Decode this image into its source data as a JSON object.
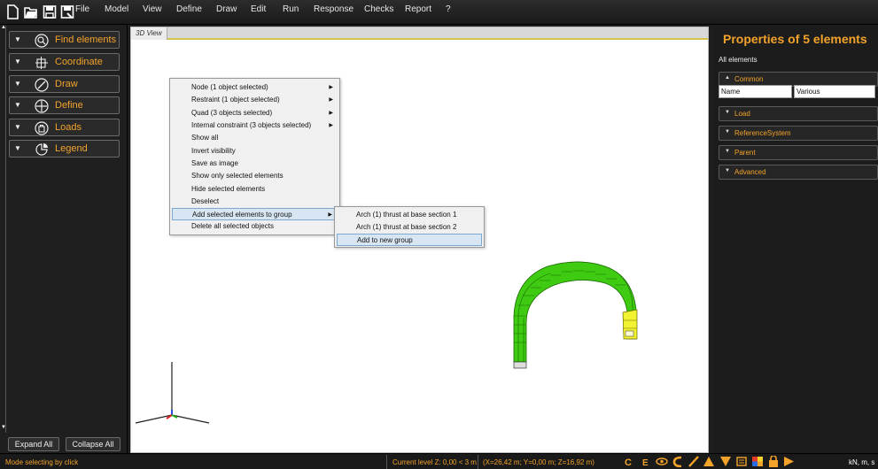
{
  "menubar": {
    "items": [
      "File",
      "Model",
      "View",
      "Define",
      "Draw",
      "Edit",
      "Run",
      "Response",
      "Checks",
      "Report",
      "?"
    ]
  },
  "left_panel": {
    "buttons": [
      {
        "label": "Find elements",
        "icon": "search-icon"
      },
      {
        "label": "Coordinate",
        "icon": "coordinate-icon"
      },
      {
        "label": "Draw",
        "icon": "draw-icon"
      },
      {
        "label": "Define",
        "icon": "define-icon"
      },
      {
        "label": "Loads",
        "icon": "loads-icon"
      },
      {
        "label": "Legend",
        "icon": "legend-icon"
      }
    ],
    "expand_all": "Expand All",
    "collapse_all": "Collapse All"
  },
  "viewport": {
    "tab_label": "3D View"
  },
  "context_menu": {
    "items": [
      {
        "label": "Node (1 object selected)",
        "submenu": true
      },
      {
        "label": "Restraint (1 object selected)",
        "submenu": true
      },
      {
        "label": "Quad (3 objects selected)",
        "submenu": true
      },
      {
        "label": "Internal constraint (3 objects selected)",
        "submenu": true
      },
      {
        "label": "Show all",
        "submenu": false
      },
      {
        "label": "Invert visibility",
        "submenu": false
      },
      {
        "label": "Save as image",
        "submenu": false
      },
      {
        "label": "Show only selected elements",
        "submenu": false
      },
      {
        "label": "Hide selected elements",
        "submenu": false
      },
      {
        "label": "Deselect",
        "submenu": false
      },
      {
        "label": "Add selected elements to group",
        "submenu": true,
        "active": true
      },
      {
        "label": "Delete all selected objects",
        "submenu": false
      }
    ],
    "submenu": {
      "items": [
        {
          "label": "Arch (1) thrust at base section 1"
        },
        {
          "label": "Arch (1) thrust at base section 2"
        },
        {
          "label": "Add to new group",
          "highlighted": true
        }
      ]
    }
  },
  "properties": {
    "title": "Properties of 5 elements",
    "subtitle": "All elements",
    "sections": [
      {
        "label": "Common",
        "expanded": true
      },
      {
        "label": "Load",
        "expanded": false
      },
      {
        "label": "ReferenceSystem",
        "expanded": false
      },
      {
        "label": "Parent",
        "expanded": false
      },
      {
        "label": "Advanced",
        "expanded": false
      }
    ],
    "common_row": {
      "name": "Name",
      "value": "Various"
    }
  },
  "status_bar": {
    "mode": "Mode selecting by click",
    "level": "Current level Z: 0,00 < 3 m",
    "coords": "(X=26,42 m; Y=0,00 m; Z=16,92 m)",
    "units": "kN, m, s"
  },
  "colors": {
    "accent": "#f3a32a",
    "arch_green": "#3ecb12",
    "arch_selected": "#f2f230",
    "ctx_highlight": "#d8e6f3"
  }
}
